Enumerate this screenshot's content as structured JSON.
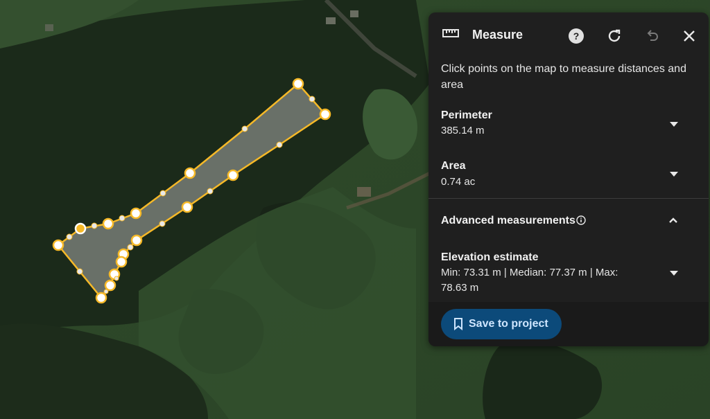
{
  "panel": {
    "title": "Measure",
    "icons": {
      "ruler": "ruler-icon",
      "help": "help-icon",
      "refresh": "refresh-icon",
      "undo": "undo-icon",
      "close": "close-icon"
    },
    "instructions": "Click points on the map to measure distances and area",
    "perimeter": {
      "label": "Perimeter",
      "value": "385.14 m"
    },
    "area": {
      "label": "Area",
      "value": "0.74 ac"
    },
    "advanced": {
      "label": "Advanced measurements",
      "info_icon": "info-icon"
    },
    "elevation": {
      "label": "Elevation estimate",
      "value": "Min: 73.31 m | Median: 77.37 m | Max: 78.63 m"
    },
    "save_button": {
      "label": "Save to project",
      "icon": "bookmark-icon"
    }
  },
  "colors": {
    "polygon_outline": "#f6b928",
    "panel_bg": "#1f1f1f",
    "save_bg": "#0c4a7a",
    "save_text": "#cfe6ff"
  }
}
